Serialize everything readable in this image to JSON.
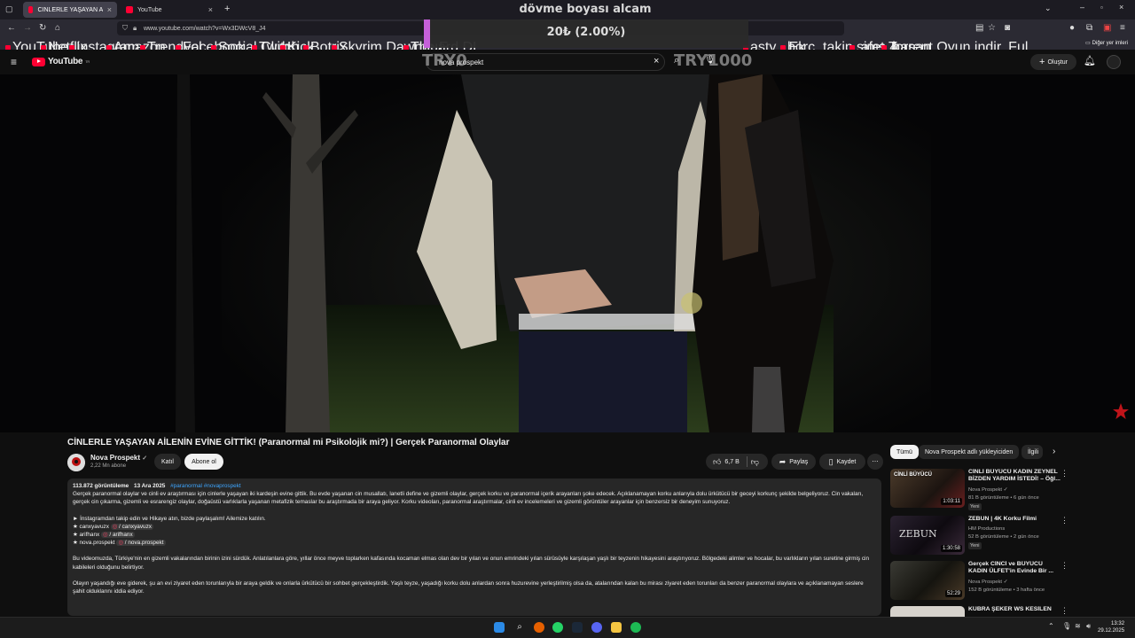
{
  "browser": {
    "tabs": [
      {
        "label": "CİNLERLE YAŞAYAN AİLENİN EV"
      },
      {
        "label": "YouTube"
      }
    ],
    "url": "www.youtube.com/watch?v=Wx3DWcV8_J4",
    "bookmarks": [
      "YouTube",
      "Netflix",
      "Instagram",
      "Amazon",
      "Trendyol",
      "Facebook",
      "Social Club",
      "Twitch",
      "Kick",
      "Botrix",
      "Skyrim Dawnguard DL...",
      "The E",
      "asty - Ek...",
      "borc_takip_afet_hasan...",
      "sims 4",
      "Torrent Oyun indir, Ful..."
    ],
    "other_bookmarks": "Diğer yer imleri"
  },
  "overlay": {
    "message": "dövme boyası alcam",
    "amount": "20₺ (2.00%)",
    "goal_min": "TRY0",
    "goal_max": "TRY1000"
  },
  "header": {
    "logo_text": "YouTube",
    "logo_sup": "TR",
    "search_value": "nova prospekt",
    "create_label": "Oluştur"
  },
  "video": {
    "title": "CİNLERLE YAŞAYAN AİLENİN EVİNE GİTTİK! (Paranormal mi Psikolojik mi?) | Gerçek Paranormal Olaylar",
    "channel": "Nova Prospekt",
    "subscribers": "2,22 Mn abone",
    "join_label": "Katıl",
    "subscribe_label": "Abone ol",
    "likes": "6,7 B",
    "share_label": "Paylaş",
    "save_label": "Kaydet"
  },
  "description": {
    "views": "113.872 görüntüleme",
    "date": "13 Ara 2025",
    "tags": "#paranormal #novaprospekt",
    "para1": "Gerçek paranormal olaylar ve cinli ev araştırması için cinlerle yaşayan iki kardeşin evine gittik. Bu evde yaşanan cin musallatı, lanetli define ve gizemli olaylar, gerçek korku ve paranormal içerik arayanları şoke edecek. Açıklanamayan korku anlarıyla dolu ürkütücü bir geceyi korkunç şekilde belgeliyoruz. Cin vakaları, gerçek cin çıkarma, gizemli ve esrarengiz olaylar, doğaüstü varlıklarla yaşanan metafizik temaslar bu araştırmada bir araya geliyor. Korku videoları, paranormal araştırmalar, cinli ev incelemeleri ve gizemli görüntüler arayanlar için benzersiz bir deneyim sunuyoruz.",
    "insta_line": "►  İnstagramdan takip edin ve Hikaye atın, bizde paylaşalım! Ailemize katılın.",
    "handles": [
      {
        "name": "★ canxyavuzx",
        "link": "/ canxyavuzx"
      },
      {
        "name": "★ arifhanx",
        "link": "/ arifhanx"
      },
      {
        "name": "★ nova.prospekt",
        "link": "/ nova.prospekt"
      }
    ],
    "para2": "Bu videomuzda, Türkiye'nin en gizemli vakalarından birinin izini sürdük. Anlatılanlara göre, yıllar önce meyve toplarken kafasında kocaman elmas olan dev bir yılan ve onun emrindeki yılan sürüsüyle karşılaşan yaşlı bir teyzenin hikayesini araştırıyoruz. Bölgedeki alimler ve hocalar, bu varlıkların yılan suretine girmiş cin kabileleri olduğunu belirtiyor.",
    "para3": "Olayın yaşandığı eve giderek, şu an evi ziyaret eden torunlarıyla bir araya geldik ve onlarla ürkütücü bir sohbet gerçekleştirdik. Yaşlı teyze, yaşadığı korku dolu anlardan sonra huzurevine yerleştirilmiş olsa da, atalarından kalan bu mirası ziyaret eden torunları da benzer paranormal olaylara ve açıklanamayan seslere şahit olduklarını iddia ediyor."
  },
  "sidebar": {
    "chips": [
      "Tümü",
      "Nova Prospekt adlı yükleyiciden",
      "İlgili"
    ],
    "recs": [
      {
        "title": "CİNLİ BÜYÜCÜ KADIN ZEYNEL BİZDEN YARDIM İSTEDİ! – Öğl...",
        "channel": "Nova Prospekt",
        "meta": "81 B görüntüleme • 6 gün önce",
        "badge": "Yeni",
        "duration": "1:03:11"
      },
      {
        "title": "ZEBUN | 4K Korku Filmi",
        "channel": "HM Productions",
        "meta": "52 B görüntüleme • 2 gün önce",
        "badge": "Yeni",
        "duration": "1:30:58",
        "thumb_text": "ZEBUN"
      },
      {
        "title": "Gerçek CİNCİ ve BÜYÜCÜ KADIN ÜLFET'in Evinde Bir ...",
        "channel": "Nova Prospekt",
        "meta": "152 B görüntüleme • 3 hafta önce",
        "duration": "52:29"
      },
      {
        "title": "KÜBRA ŞEKER WS KESİLEN",
        "channel": "",
        "meta": ""
      }
    ]
  },
  "taskbar": {
    "time": "13:32",
    "date": "29.12.2025"
  },
  "colors": {
    "accent": "#ff0033",
    "link": "#3ea6ff",
    "goal_bar": "#c560d9"
  }
}
